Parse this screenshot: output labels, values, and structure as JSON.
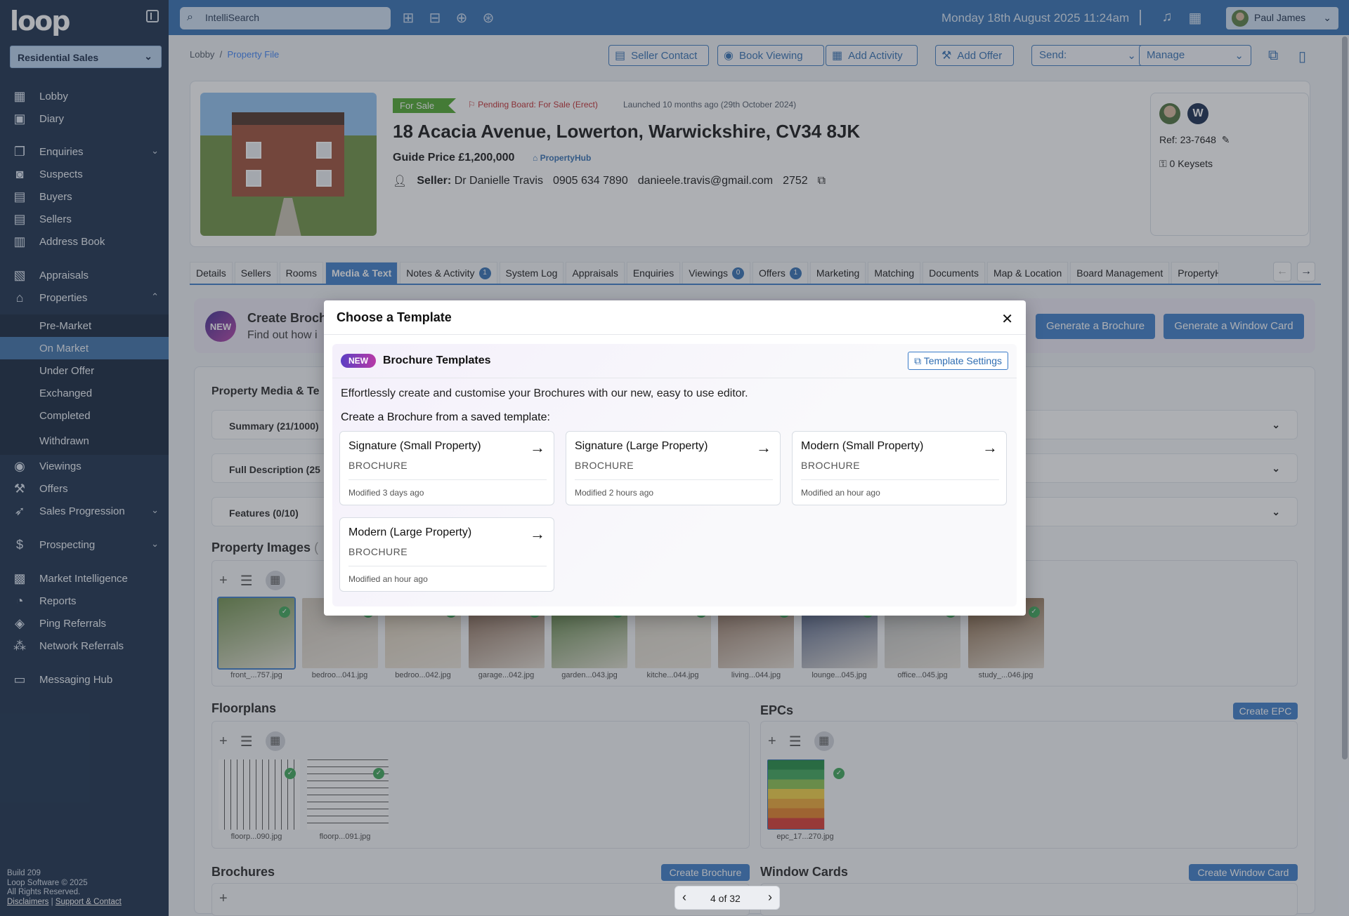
{
  "app": {
    "logo": "loop",
    "branch": "Residential Sales"
  },
  "sidebar": {
    "items": [
      {
        "label": "Lobby",
        "icon": "grid-icon"
      },
      {
        "label": "Diary",
        "icon": "calendar-icon"
      },
      {
        "label": "Enquiries",
        "icon": "chat-icon"
      },
      {
        "label": "Suspects",
        "icon": "badge-icon"
      },
      {
        "label": "Buyers",
        "icon": "card-icon"
      },
      {
        "label": "Sellers",
        "icon": "card-icon"
      },
      {
        "label": "Address Book",
        "icon": "book-icon"
      },
      {
        "label": "Appraisals",
        "icon": "clipboard-icon"
      },
      {
        "label": "Properties",
        "icon": "house-icon"
      },
      {
        "label": "Viewings",
        "icon": "eye-icon"
      },
      {
        "label": "Offers",
        "icon": "gavel-icon"
      },
      {
        "label": "Sales Progression",
        "icon": "rocket-icon"
      },
      {
        "label": "Prospecting",
        "icon": "dollar-icon"
      },
      {
        "label": "Market Intelligence",
        "icon": "chart-icon"
      },
      {
        "label": "Reports",
        "icon": "pie-icon"
      },
      {
        "label": "Ping Referrals",
        "icon": "handshake-icon"
      },
      {
        "label": "Network Referrals",
        "icon": "network-icon"
      },
      {
        "label": "Messaging Hub",
        "icon": "message-icon"
      }
    ],
    "properties_sub": [
      "Pre-Market",
      "On Market",
      "Under Offer",
      "Exchanged",
      "Completed",
      "Withdrawn"
    ],
    "footer": {
      "build": "Build 209",
      "copyright": "Loop Software © 2025",
      "rights": "All Rights Reserved.",
      "disclaimers": "Disclaimers",
      "sep": "|",
      "support": "Support & Contact"
    }
  },
  "topbar": {
    "search_placeholder": "IntelliSearch",
    "datetime": "Monday 18th August 2025 11:24am",
    "user": "Paul James"
  },
  "breadcrumb": {
    "root": "Lobby",
    "sep": "/",
    "current": "Property File"
  },
  "actions": {
    "seller_contact": "Seller Contact",
    "book_viewing": "Book Viewing",
    "add_activity": "Add Activity",
    "add_offer": "Add Offer",
    "send": "Send:",
    "manage": "Manage"
  },
  "property": {
    "status": "For Sale",
    "pending": "Pending Board: For Sale (Erect)",
    "launched": "Launched 10 months ago (29th October 2024)",
    "address": "18 Acacia Avenue, Lowerton, Warwickshire, CV34 8JK",
    "guide": "Guide Price £1,200,000",
    "portal": "PropertyHub",
    "seller_label": "Seller:",
    "seller_name": "Dr Danielle Travis",
    "phone": "0905 634 7890",
    "email": "danieele.travis@gmail.com",
    "code": "2752",
    "ref": "Ref: 23-7648",
    "keysets": "0 Keysets",
    "agent_initial": "W"
  },
  "tabs": [
    {
      "label": "Details"
    },
    {
      "label": "Sellers"
    },
    {
      "label": "Rooms"
    },
    {
      "label": "Media & Text"
    },
    {
      "label": "Notes & Activity",
      "count": "1"
    },
    {
      "label": "System Log"
    },
    {
      "label": "Appraisals"
    },
    {
      "label": "Enquiries"
    },
    {
      "label": "Viewings",
      "count": "0"
    },
    {
      "label": "Offers",
      "count": "1"
    },
    {
      "label": "Marketing"
    },
    {
      "label": "Matching"
    },
    {
      "label": "Documents"
    },
    {
      "label": "Map & Location"
    },
    {
      "label": "Board Management"
    },
    {
      "label": "PropertyHu"
    }
  ],
  "promo": {
    "badge": "NEW",
    "title": "Create Broch",
    "subtitle": "Find out how i",
    "gen_brochure": "Generate a Brochure",
    "gen_window": "Generate a Window Card"
  },
  "media": {
    "title": "Property Media & Te",
    "summary": "Summary (21/1000)",
    "full_desc": "Full Description (25",
    "features": "Features (0/10)",
    "images_title": "Property Images",
    "images_count": "(",
    "images": [
      "front_...757.jpg",
      "bedroo...041.jpg",
      "bedroo...042.jpg",
      "garage...042.jpg",
      "garden...043.jpg",
      "kitche...044.jpg",
      "living...044.jpg",
      "lounge...045.jpg",
      "office...045.jpg",
      "study_...046.jpg"
    ],
    "floorplans_title": "Floorplans",
    "floorplans": [
      "floorp...090.jpg",
      "floorp...091.jpg"
    ],
    "epcs_title": "EPCs",
    "create_epc": "Create EPC",
    "epcs": [
      "epc_17...270.jpg"
    ],
    "brochures_title": "Brochures",
    "create_brochure": "Create Brochure",
    "window_title": "Window Cards",
    "create_window": "Create Window Card"
  },
  "pager": {
    "text": "4 of 32"
  },
  "modal": {
    "title": "Choose a Template",
    "badge": "NEW",
    "section": "Brochure Templates",
    "settings": "Template Settings",
    "desc": "Effortlessly create and customise your Brochures with our new, easy to use editor.",
    "prompt": "Create a Brochure from a saved template:",
    "templates": [
      {
        "name": "Signature (Small Property)",
        "kind": "BROCHURE",
        "modified": "Modified 3 days ago"
      },
      {
        "name": "Signature (Large Property)",
        "kind": "BROCHURE",
        "modified": "Modified 2 hours ago"
      },
      {
        "name": "Modern (Small Property)",
        "kind": "BROCHURE",
        "modified": "Modified an hour ago"
      },
      {
        "name": "Modern (Large Property)",
        "kind": "BROCHURE",
        "modified": "Modified an hour ago"
      }
    ]
  },
  "colors": {
    "sidebar": "#152a48",
    "topbar": "#2f6db2",
    "accent": "#3a7bc8",
    "sale": "#4aa528"
  }
}
